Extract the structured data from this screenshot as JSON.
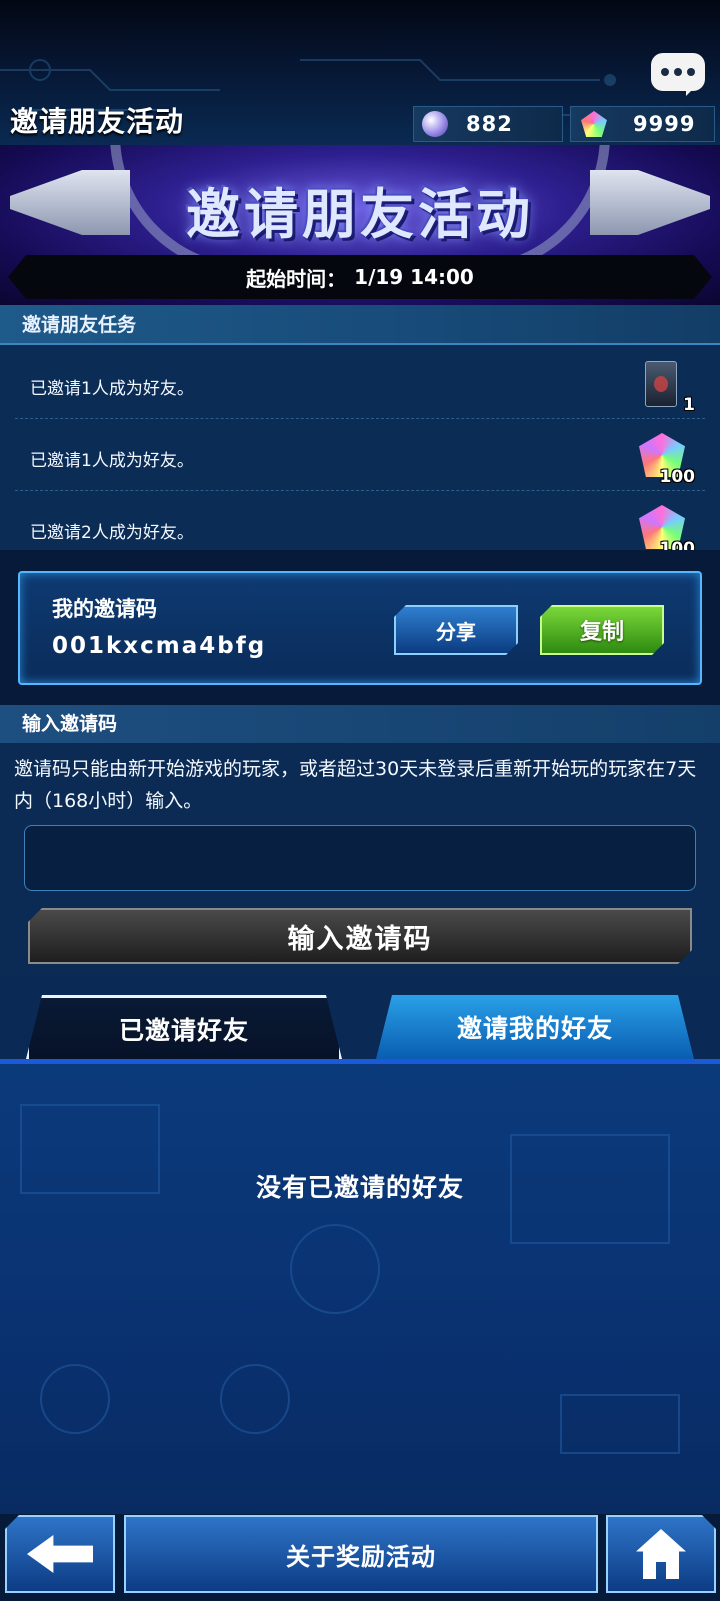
{
  "header": {
    "title": "邀请朋友活动",
    "currency_orb": "882",
    "currency_gem": "9999",
    "chat_icon": "chat-bubble-icon"
  },
  "banner": {
    "title": "邀请朋友活动",
    "start_label": "起始时间：",
    "start_time": "1/19 14:00"
  },
  "missions": {
    "heading": "邀请朋友任务",
    "items": [
      {
        "text": "已邀请1人成为好友。",
        "reward_icon": "card-pack-icon",
        "qty": "1"
      },
      {
        "text": "已邀请1人成为好友。",
        "reward_icon": "gem-icon",
        "qty": "100"
      },
      {
        "text": "已邀请2人成为好友。",
        "reward_icon": "gem-icon",
        "qty": "100"
      }
    ]
  },
  "my_code": {
    "label": "我的邀请码",
    "value": "001kxcma4bfg",
    "share_label": "分享",
    "copy_label": "复制"
  },
  "enter_code": {
    "heading": "输入邀请码",
    "note": "邀请码只能由新开始游戏的玩家，或者超过30天未登录后重新开始玩的玩家在7天内（168小时）输入。",
    "input_value": "",
    "button_label": "输入邀请码"
  },
  "tabs": [
    {
      "label": "已邀请好友",
      "active": true
    },
    {
      "label": "邀请我的好友",
      "active": false
    }
  ],
  "empty_message": "没有已邀请的好友",
  "footer": {
    "about_label": "关于奖励活动",
    "back_icon": "back-arrow-icon",
    "home_icon": "home-icon"
  },
  "colors": {
    "accent_blue": "#2f74c8",
    "copy_green": "#4fb020",
    "background": "#0b2b55"
  }
}
